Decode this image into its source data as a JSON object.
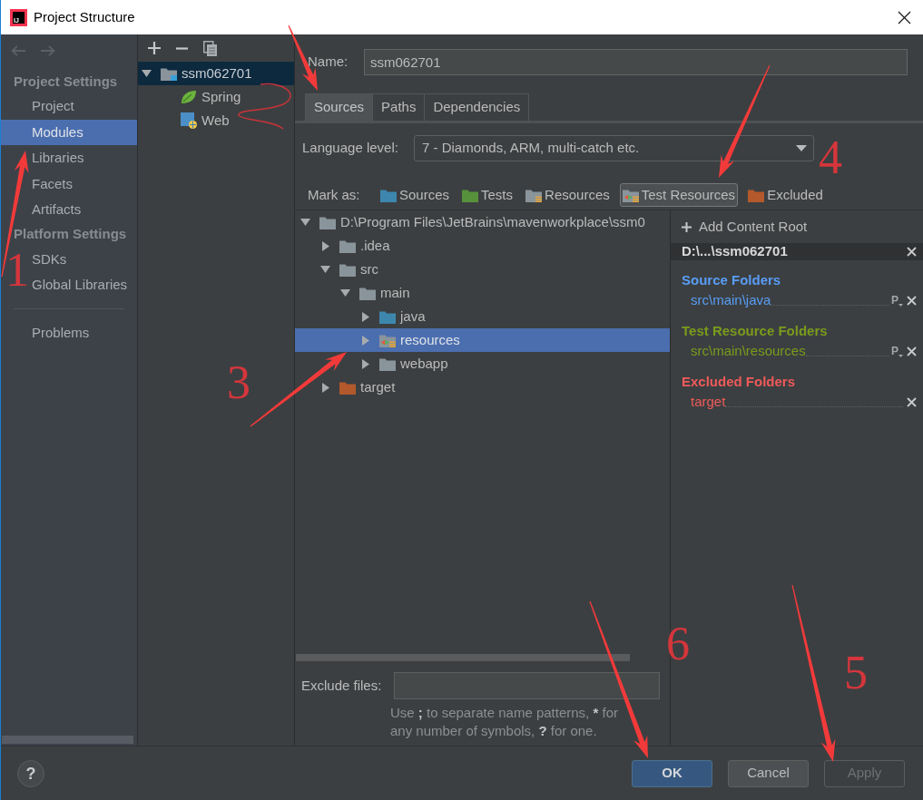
{
  "window": {
    "logo_text": "IJ",
    "title": "Project Structure"
  },
  "sidebar": {
    "sections": [
      {
        "header": "Project Settings",
        "items": [
          {
            "label": "Project",
            "selected": false
          },
          {
            "label": "Modules",
            "selected": true
          },
          {
            "label": "Libraries",
            "selected": false
          },
          {
            "label": "Facets",
            "selected": false
          },
          {
            "label": "Artifacts",
            "selected": false
          }
        ]
      },
      {
        "header": "Platform Settings",
        "items": [
          {
            "label": "SDKs",
            "selected": false
          },
          {
            "label": "Global Libraries",
            "selected": false
          }
        ]
      },
      {
        "items": [
          {
            "label": "Problems",
            "selected": false
          }
        ]
      }
    ]
  },
  "module_tree": [
    {
      "label": "ssm062701",
      "kind": "module",
      "selected": true,
      "expanded": true,
      "children": [
        {
          "label": "Spring",
          "kind": "spring",
          "selected": false
        },
        {
          "label": "Web",
          "kind": "web",
          "selected": false
        }
      ]
    }
  ],
  "name_field": {
    "label": "Name:",
    "value": "ssm062701"
  },
  "tabs": [
    {
      "label": "Sources",
      "selected": true
    },
    {
      "label": "Paths",
      "selected": false
    },
    {
      "label": "Dependencies",
      "selected": false
    }
  ],
  "language_level": {
    "label": "Language level:",
    "value": "7 - Diamonds, ARM, multi-catch etc."
  },
  "mark_as": {
    "label": "Mark as:",
    "options": [
      {
        "label": "Sources",
        "kind": "source",
        "selected": false
      },
      {
        "label": "Tests",
        "kind": "tests",
        "selected": false
      },
      {
        "label": "Resources",
        "kind": "resources",
        "selected": false
      },
      {
        "label": "Test Resources",
        "kind": "test_resource",
        "selected": true
      },
      {
        "label": "Excluded",
        "kind": "excluded",
        "selected": false
      }
    ]
  },
  "file_tree": [
    {
      "label": "D:\\Program Files\\JetBrains\\mavenworkplace\\ssm0",
      "kind": "folder",
      "expanded": true,
      "selected": false,
      "children": [
        {
          "label": ".idea",
          "kind": "folder",
          "expanded": false,
          "selected": false
        },
        {
          "label": "src",
          "kind": "folder",
          "expanded": true,
          "selected": false,
          "children": [
            {
              "label": "main",
              "kind": "folder",
              "expanded": true,
              "selected": false,
              "children": [
                {
                  "label": "java",
                  "kind": "source",
                  "expanded": false,
                  "selected": false
                },
                {
                  "label": "resources",
                  "kind": "test_resource",
                  "expanded": false,
                  "selected": true
                },
                {
                  "label": "webapp",
                  "kind": "folder",
                  "expanded": false,
                  "selected": false
                }
              ]
            }
          ]
        },
        {
          "label": "target",
          "kind": "excluded",
          "expanded": false,
          "selected": false
        }
      ]
    }
  ],
  "exclude_files": {
    "label": "Exclude files:",
    "hint": [
      {
        "text": "Use ",
        "bold": false
      },
      {
        "text": ";",
        "bold": true
      },
      {
        "text": " to separate name patterns, ",
        "bold": false
      },
      {
        "text": "*",
        "bold": true
      },
      {
        "text": " for any number of symbols, ",
        "bold": false
      },
      {
        "text": "?",
        "bold": true
      },
      {
        "text": " for one.",
        "bold": false
      }
    ]
  },
  "content_root": {
    "add_label": "Add Content Root",
    "path": "D:\\...\\ssm062701",
    "groups": [
      {
        "title": "Source Folders",
        "kind": "source",
        "folders": [
          {
            "path": "src\\main\\java",
            "prefix_button": "P"
          }
        ]
      },
      {
        "title": "Test Resource Folders",
        "kind": "test_resource",
        "folders": [
          {
            "path": "src\\main\\resources",
            "prefix_button": "P"
          }
        ]
      },
      {
        "title": "Excluded Folders",
        "kind": "excluded",
        "folders": [
          {
            "path": "target"
          }
        ]
      }
    ]
  },
  "help_button": "?",
  "buttons": [
    {
      "label": "OK",
      "kind": "default",
      "disabled": false
    },
    {
      "label": "Cancel",
      "kind": "normal",
      "disabled": false
    },
    {
      "label": "Apply",
      "kind": "normal",
      "disabled": true
    }
  ],
  "annotations": [
    {
      "kind": "arrow"
    },
    {
      "kind": "arrow"
    },
    {
      "kind": "arrow"
    },
    {
      "kind": "arrow"
    },
    {
      "kind": "arrow"
    },
    {
      "kind": "arrow"
    },
    {
      "kind": "scribble"
    },
    {
      "kind": "number",
      "text": "1"
    },
    {
      "kind": "number",
      "text": "3"
    },
    {
      "kind": "number",
      "text": "4"
    },
    {
      "kind": "number",
      "text": "5"
    },
    {
      "kind": "number",
      "text": "6"
    }
  ]
}
